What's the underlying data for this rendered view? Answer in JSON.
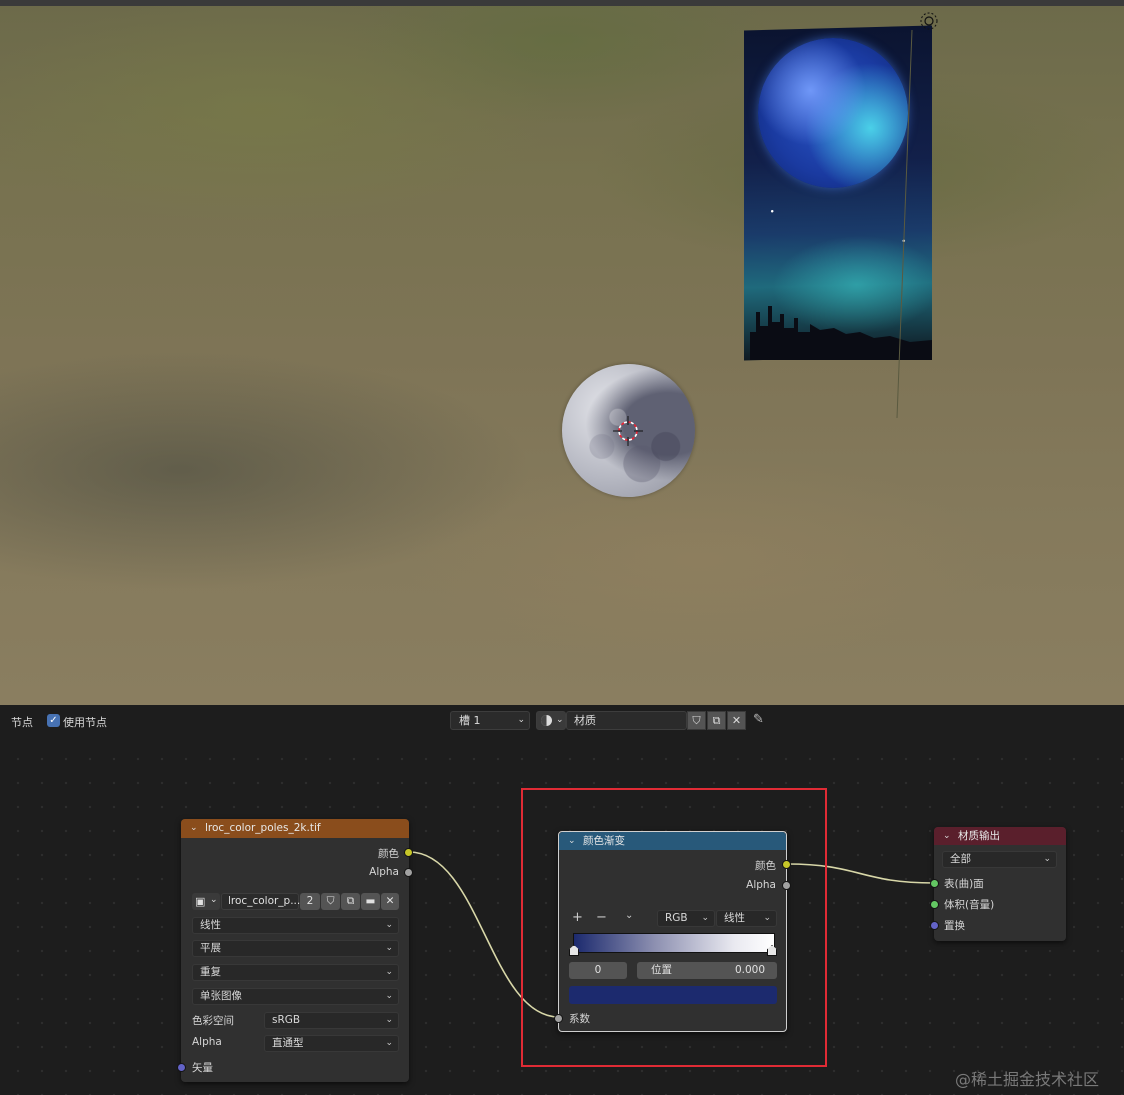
{
  "header": {
    "menu_label": "节点",
    "use_nodes_label": "使用节点",
    "slot_label": "槽 1",
    "material_name": "材质"
  },
  "image_node": {
    "title": "lroc_color_poles_2k.tif",
    "out_color": "颜色",
    "out_alpha": "Alpha",
    "image_name": "lroc_color_p...",
    "user_count": "2",
    "interpolation": "线性",
    "projection": "平展",
    "extension": "重复",
    "source": "单张图像",
    "colorspace_label": "色彩空间",
    "colorspace_value": "sRGB",
    "alpha_label": "Alpha",
    "alpha_value": "直通型",
    "in_vector": "矢量"
  },
  "ramp_node": {
    "title": "颜色渐变",
    "out_color": "颜色",
    "out_alpha": "Alpha",
    "add_symbol": "+",
    "remove_symbol": "−",
    "color_mode": "RGB",
    "interpolation": "线性",
    "stop_index": "0",
    "position_label": "位置",
    "position_value": "0.000",
    "stop_color": "#1c2a6e",
    "in_fac": "系数"
  },
  "output_node": {
    "title": "材质输出",
    "target": "全部",
    "in_surface": "表(曲)面",
    "in_volume": "体积(音量)",
    "in_displacement": "置换"
  },
  "colors": {
    "image_header": "#8a4d1c",
    "ramp_header": "#28597a",
    "output_header": "#5a1f2c",
    "color_socket": "#c7c729",
    "gray_socket": "#a1a1a1",
    "vector_socket": "#6363c7",
    "shader_socket": "#63c763",
    "highlight": "#e02b35"
  },
  "watermark": "@稀土掘金技术社区"
}
